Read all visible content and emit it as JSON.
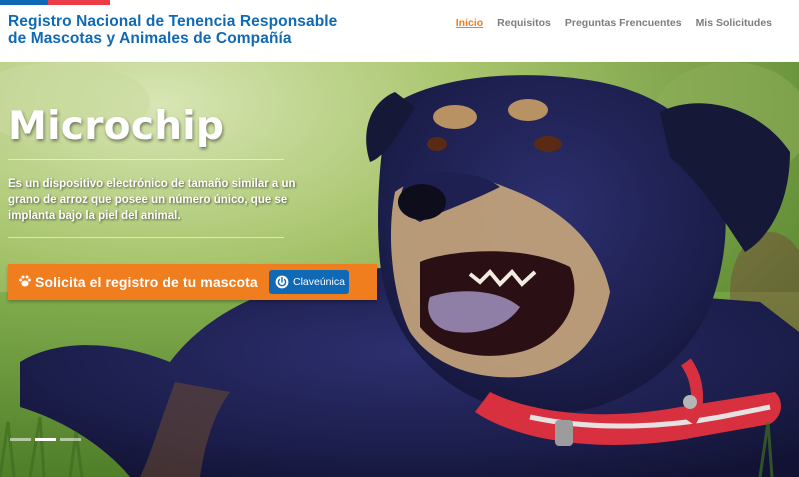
{
  "header": {
    "title_line1": "Registro Nacional de Tenencia Responsable",
    "title_line2": "de Mascotas y Animales de Compañía",
    "brand_colors": {
      "blue": "#0f69b4",
      "red": "#eb3c46",
      "orange": "#f07d1e"
    }
  },
  "nav": {
    "items": [
      {
        "label": "Inicio",
        "active": true
      },
      {
        "label": "Requisitos",
        "active": false
      },
      {
        "label": "Preguntas Frencuentes",
        "active": false
      },
      {
        "label": "Mis Solicitudes",
        "active": false
      }
    ]
  },
  "hero": {
    "heading": "Microchip",
    "description": "Es un dispositivo electrónico de tamaño similar a un grano de arroz que posee un número único, que se implanta bajo la piel del animal.",
    "cta_label": "Solicita el registro de tu mascota",
    "cta_icon": "paw-icon",
    "clave_label": "Claveúnica",
    "clave_icon": "power-icon",
    "slides_total": 3,
    "slide_active": 2
  }
}
